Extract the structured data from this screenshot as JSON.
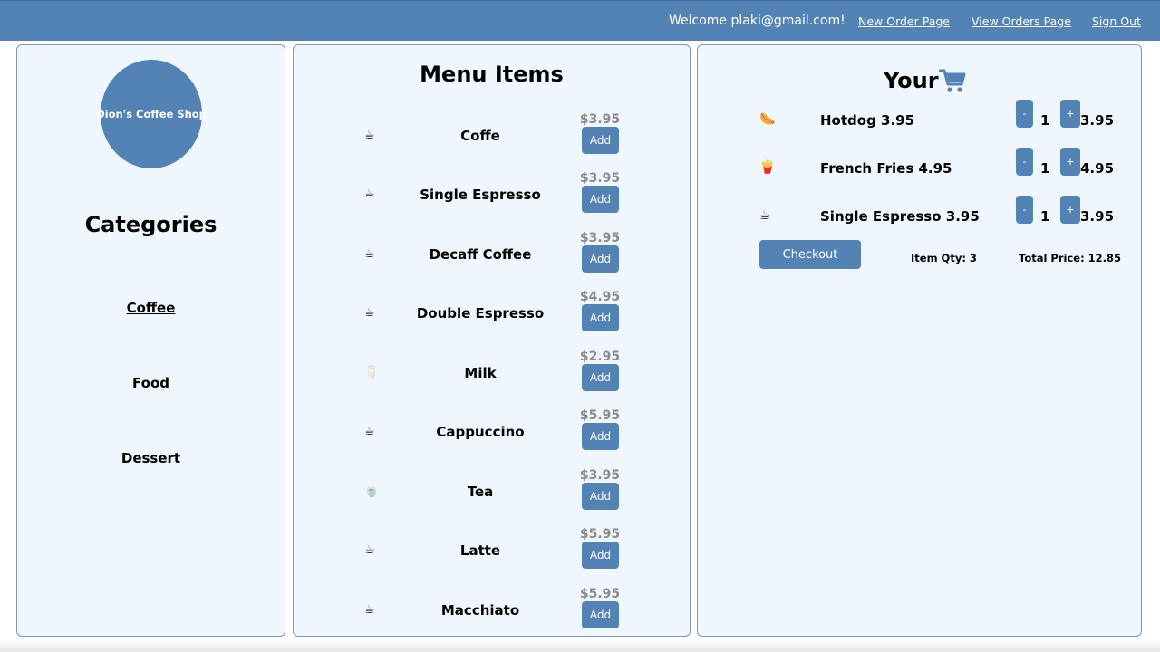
{
  "header": {
    "welcome": "Welcome plaki@gmail.com!",
    "links": [
      "New Order Page",
      "View Orders Page",
      "Sign Out"
    ]
  },
  "sidebar": {
    "logo": "Dion's Coffee Shop",
    "title": "Categories",
    "items": [
      {
        "label": "Coffee",
        "active": true
      },
      {
        "label": "Food",
        "active": false
      },
      {
        "label": "Dessert",
        "active": false
      }
    ]
  },
  "menu": {
    "title": "Menu Items",
    "add_label": "Add",
    "items": [
      {
        "icon": "☕",
        "name": "Coffe",
        "price": "$3.95"
      },
      {
        "icon": "☕",
        "name": "Single Espresso",
        "price": "$3.95"
      },
      {
        "icon": "☕",
        "name": "Decaff Coffee",
        "price": "$3.95"
      },
      {
        "icon": "☕",
        "name": "Double Espresso",
        "price": "$4.95"
      },
      {
        "icon": "🥛",
        "name": "Milk",
        "price": "$2.95"
      },
      {
        "icon": "☕",
        "name": "Cappuccino",
        "price": "$5.95"
      },
      {
        "icon": "🍵",
        "name": "Tea",
        "price": "$3.95"
      },
      {
        "icon": "☕",
        "name": "Latte",
        "price": "$5.95"
      },
      {
        "icon": "☕",
        "name": "Macchiato",
        "price": "$5.95"
      }
    ]
  },
  "cart": {
    "title": "Your",
    "title_icon": "cart-icon",
    "minus_label": "-",
    "plus_label": "+",
    "items": [
      {
        "icon": "🌭",
        "name": "Hotdog   3.95",
        "qty": "1",
        "total": "3.95"
      },
      {
        "icon": "🍟",
        "name": "French Fries   4.95",
        "qty": "1",
        "total": "4.95"
      },
      {
        "icon": "☕",
        "name": "Single Espresso   3.95",
        "qty": "1",
        "total": "3.95"
      }
    ],
    "checkout_label": "Checkout",
    "item_qty": "Item Qty: 3",
    "total_price": "Total Price: 12.85"
  },
  "colors": {
    "accent": "#5383b5",
    "panel_bg": "#eff6fd",
    "price_gray": "#8a8a8a"
  }
}
